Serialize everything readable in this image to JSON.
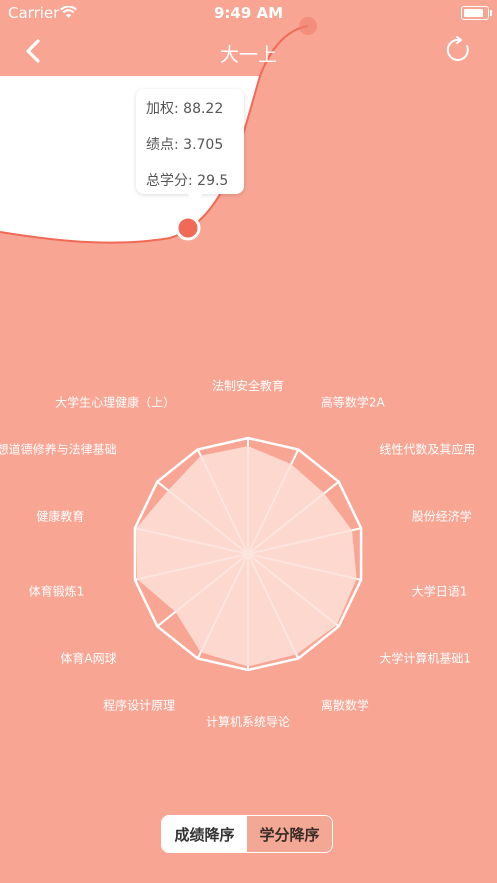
{
  "status": {
    "carrier": "Carrier",
    "time": "9:49 AM"
  },
  "nav": {
    "title": "大一上",
    "icons": {
      "back": "chevron-left-icon",
      "refresh": "refresh-icon"
    }
  },
  "tooltip": {
    "weighted": "加权: 88.22",
    "gpa": "绩点: 3.705",
    "credits": "总学分: 29.5"
  },
  "sort": {
    "by_score": "成绩降序",
    "by_credit": "学分降序",
    "selected": "by_score"
  },
  "colors": {
    "background": "#f8a594",
    "accent": "#f06a55",
    "radar_fill": "#fde0d9"
  },
  "chart_data": {
    "type": "radar",
    "categories": [
      "法制安全教育",
      "高等数学2A",
      "线性代数及其应用",
      "股份经济学",
      "大学日语1",
      "大学计算机基础1",
      "离散数学",
      "计算机系统导论",
      "程序设计原理",
      "体育A网球",
      "体育锻炼1",
      "健康教育",
      "思想道德修养与法律基础",
      "大学生心理健康（上）"
    ],
    "values": [
      0.93,
      0.86,
      0.84,
      0.92,
      0.96,
      0.98,
      0.96,
      0.97,
      0.94,
      0.8,
      0.98,
      0.99,
      0.88,
      0.94
    ],
    "range": [
      0,
      1
    ]
  }
}
